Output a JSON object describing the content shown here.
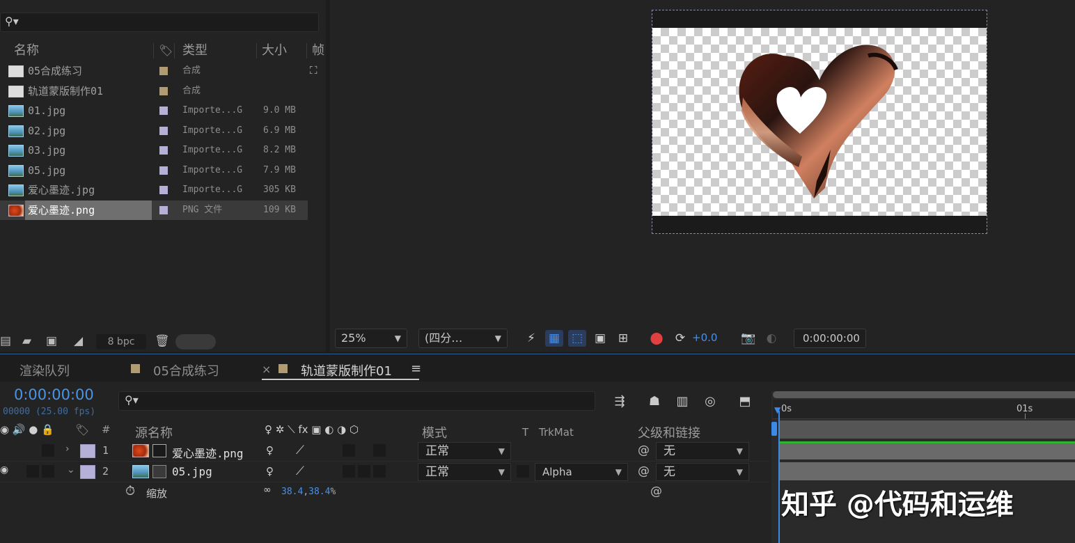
{
  "project": {
    "columns": {
      "name": "名称",
      "type": "类型",
      "size": "大小",
      "frames": "帧"
    },
    "items": [
      {
        "name": "05合成练习",
        "type": "合成",
        "size": "",
        "kind": "comp",
        "color": "#b09b72"
      },
      {
        "name": "轨道蒙版制作01",
        "type": "合成",
        "size": "",
        "kind": "comp",
        "color": "#b09b72"
      },
      {
        "name": "01.jpg",
        "type": "Importe...G",
        "size": "9.0 MB",
        "kind": "img",
        "color": "#b4b0d8"
      },
      {
        "name": "02.jpg",
        "type": "Importe...G",
        "size": "6.9 MB",
        "kind": "img",
        "color": "#b4b0d8"
      },
      {
        "name": "03.jpg",
        "type": "Importe...G",
        "size": "8.2 MB",
        "kind": "img",
        "color": "#b4b0d8"
      },
      {
        "name": "05.jpg",
        "type": "Importe...G",
        "size": "7.9 MB",
        "kind": "img",
        "color": "#b4b0d8"
      },
      {
        "name": "爱心墨迹.jpg",
        "type": "Importe...G",
        "size": "305 KB",
        "kind": "img",
        "color": "#b4b0d8"
      },
      {
        "name": "爱心墨迹.png",
        "type": "PNG 文件",
        "size": "109 KB",
        "kind": "png",
        "color": "#b4b0d8",
        "selected": true
      }
    ],
    "footer": {
      "bpc": "8 bpc"
    }
  },
  "viewer": {
    "zoom": "25%",
    "resolution": "(四分…",
    "exposure": "+0.0",
    "timecode": "0:00:00:00"
  },
  "tabs": [
    {
      "label": "渲染队列"
    },
    {
      "label": "05合成练习"
    },
    {
      "label": "轨道蒙版制作01",
      "active": true,
      "close": "×",
      "menu": "≡"
    }
  ],
  "timeline": {
    "timecode": "0:00:00:00",
    "frames_fps": "00000 (25.00 fps)",
    "headers": {
      "num": "#",
      "source": "源名称",
      "mode": "模式",
      "t": "T",
      "trkmat": "TrkMat",
      "parent": "父级和链接"
    },
    "layers": [
      {
        "num": "1",
        "name": "爱心墨迹.png",
        "mode": "正常",
        "trkmat": "",
        "parent": "无"
      },
      {
        "num": "2",
        "name": "05.jpg",
        "mode": "正常",
        "trkmat": "Alpha",
        "parent": "无"
      }
    ],
    "property": {
      "name": "缩放",
      "value_x": "38.4",
      "sep": ",",
      "value_y": "38.4",
      "unit": "%"
    },
    "ruler": {
      "start": "0s",
      "tick1": "01s"
    }
  },
  "watermark": "知乎 @代码和运维"
}
